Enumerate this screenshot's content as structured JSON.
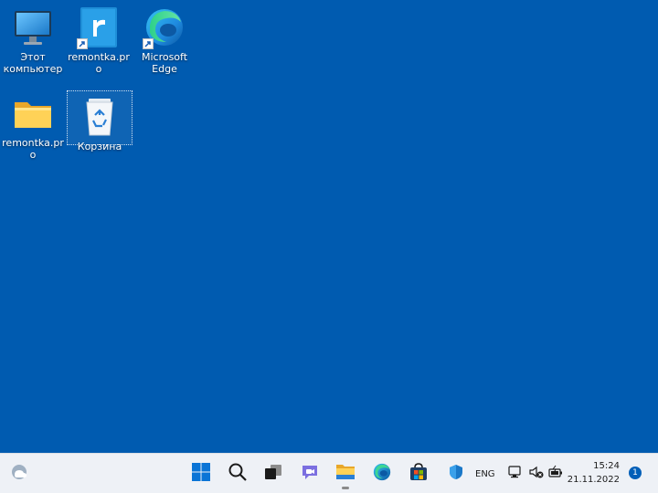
{
  "desktop": {
    "icons": [
      {
        "id": "this-pc",
        "label": "Этот компьютер",
        "icon": "monitor-icon"
      },
      {
        "id": "remontka-shortcut",
        "label": "remontka.pro",
        "icon": "remontka-r-icon"
      },
      {
        "id": "edge-shortcut",
        "label": "Microsoft Edge",
        "icon": "edge-icon"
      },
      {
        "id": "remontka-folder",
        "label": "remontka.pro",
        "icon": "folder-icon"
      },
      {
        "id": "recycle-bin",
        "label": "Корзина",
        "icon": "recycle-bin-icon"
      }
    ],
    "background_color": "#005bb0"
  },
  "taskbar": {
    "widgets_icon": "weather-widget-icon",
    "pinned": [
      {
        "id": "start",
        "icon": "windows-start-icon"
      },
      {
        "id": "search",
        "icon": "search-icon"
      },
      {
        "id": "task-view",
        "icon": "task-view-icon"
      },
      {
        "id": "chat",
        "icon": "teams-chat-icon"
      },
      {
        "id": "explorer",
        "icon": "file-explorer-icon",
        "active": true
      },
      {
        "id": "edge",
        "icon": "edge-icon"
      },
      {
        "id": "store",
        "icon": "store-icon"
      }
    ],
    "tray": {
      "language": "ENG",
      "time": "15:24",
      "date": "21.11.2022",
      "notifications": "1"
    },
    "background_color": "#eef1f6"
  }
}
